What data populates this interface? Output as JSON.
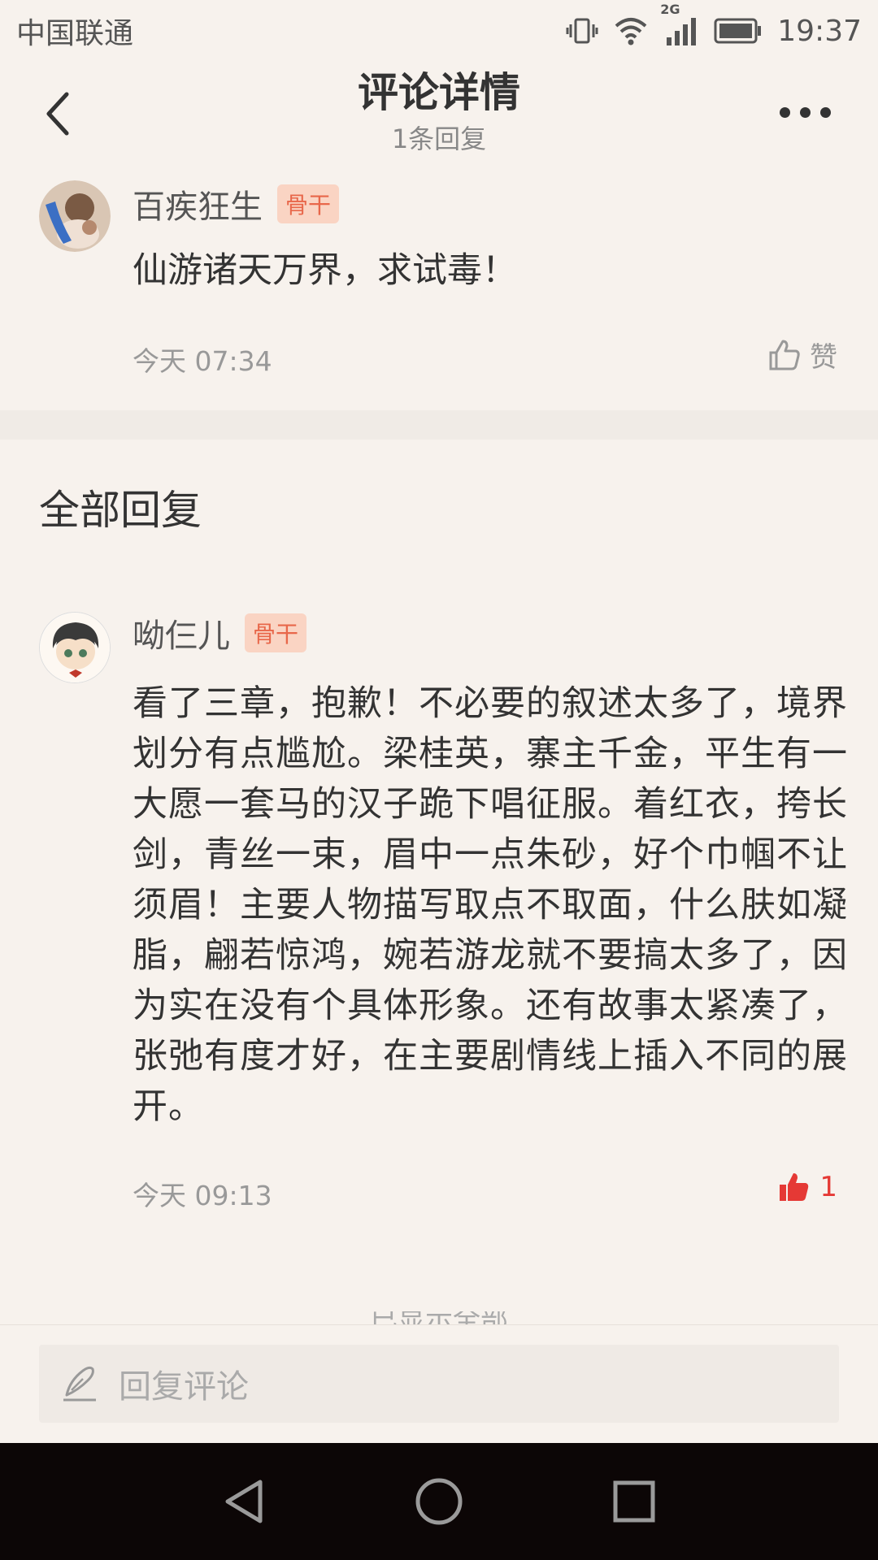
{
  "status_bar": {
    "carrier": "中国联通",
    "network": "2G",
    "time": "19:37"
  },
  "nav": {
    "title": "评论详情",
    "subtitle": "1条回复",
    "back_icon": "chevron-left-icon",
    "more_icon": "more-dots-icon"
  },
  "main_comment": {
    "user_name": "百疾狂生",
    "badge": "骨干",
    "text": "仙游诸天万界，求试毒！",
    "time": "今天 07:34",
    "like_label": "赞"
  },
  "replies_section": {
    "title": "全部回复"
  },
  "replies": [
    {
      "user_name": "呦仨儿",
      "badge": "骨干",
      "text": "看了三章，抱歉！不必要的叙述太多了，境界划分有点尴尬。梁桂英，寨主千金，平生有一大愿一套马的汉子跪下唱征服。着红衣，挎长剑，青丝一束，眉中一点朱砂，好个巾帼不让须眉！主要人物描写取点不取面，什么肤如凝脂，翩若惊鸿，婉若游龙就不要搞太多了，因为实在没有个具体形象。还有故事太紧凑了，张弛有度才好，在主要剧情线上插入不同的展开。",
      "time": "今天 09:13",
      "likes": "1"
    }
  ],
  "end_text": "已显示全部",
  "reply_box": {
    "placeholder": "回复评论"
  },
  "colors": {
    "background": "#f7f2ed",
    "badge_text": "#e8674a",
    "badge_bg": "#fad4c3",
    "like_active": "#e53935"
  }
}
